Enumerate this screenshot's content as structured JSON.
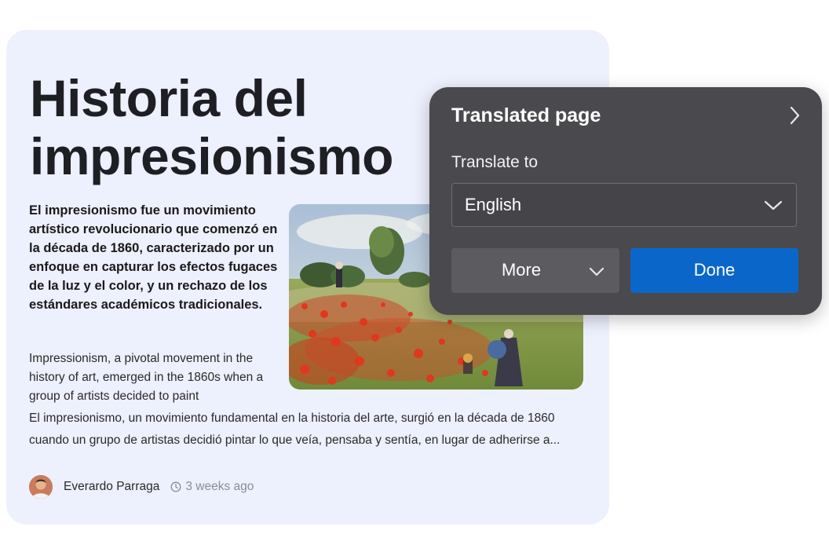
{
  "article": {
    "title": "Historia del impresionismo",
    "lead": "El impresionismo fue un movimiento artístico revolucionario que comenzó en la década de 1860, caracterizado por un enfoque en capturar los efectos fugaces de la luz y el color, y un rechazo de los estándares académicos tradicionales.",
    "body_english": "Impressionism, a pivotal movement in the history of art, emerged in the 1860s when a group of artists decided to paint",
    "body_spanish": "El impresionismo, un movimiento fundamental en la historia del arte, surgió en la década de 1860 cuando un grupo de artistas decidió pintar lo que veía, pensaba y sentía, en lugar de adherirse a...",
    "author": "Everardo Parraga",
    "time_ago": "3 weeks ago",
    "image_icon": "poppy-field-painting"
  },
  "translate_panel": {
    "title": "Translated page",
    "label": "Translate to",
    "selected_language": "English",
    "more_label": "More",
    "done_label": "Done",
    "colors": {
      "panel_bg": "#4a494d",
      "done_bg": "#0a67c9",
      "more_bg": "#5c5b60"
    }
  },
  "colors": {
    "card_bg": "#edf0fd",
    "title_text": "#1e1f24",
    "muted_text": "#8a8d96"
  }
}
